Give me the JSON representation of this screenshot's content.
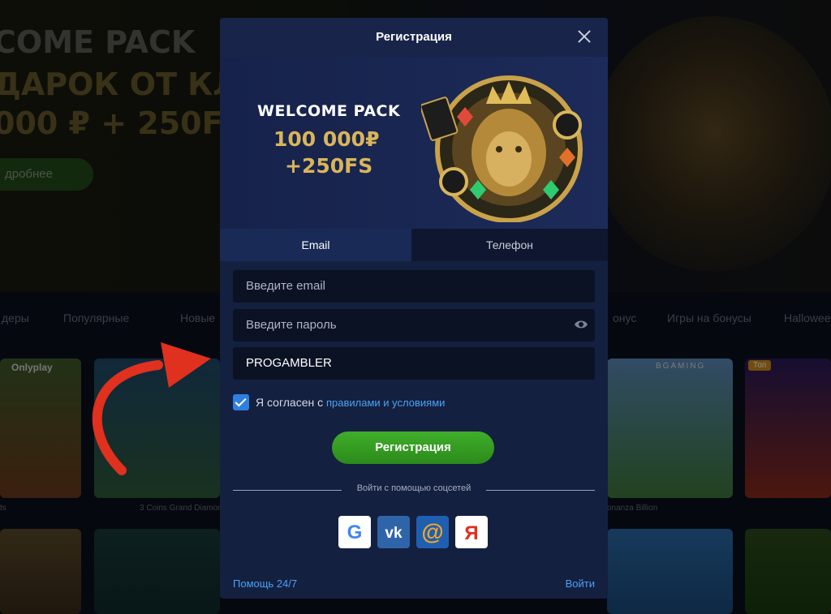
{
  "background": {
    "hero": {
      "title_line1": "COME PACK",
      "title_line2": "ДАРОК ОТ КЛУ",
      "title_line3": "000 ₽ + 250FS",
      "button_label": "дробнее"
    },
    "categories": [
      "деры",
      "Популярные",
      "Новые",
      "онус",
      "Игры на бонусы",
      "Hallowee"
    ],
    "tiles": [
      {
        "label": "ts",
        "provider": "Onlyplay"
      },
      {
        "label": "3 Coins Grand Diamond"
      },
      {
        "label": "onanza Billion",
        "provider": "BGAMING"
      },
      {
        "label": "Wi",
        "badge": "Топ"
      }
    ]
  },
  "modal": {
    "title": "Регистрация",
    "banner": {
      "line1": "WELCOME PACK",
      "line2": "100 000₽",
      "line3": "+250FS"
    },
    "tabs": [
      {
        "label": "Email",
        "active": true
      },
      {
        "label": "Телефон",
        "active": false
      }
    ],
    "fields": {
      "email_placeholder": "Введите email",
      "password_placeholder": "Введите пароль",
      "promo_value": "PROGAMBLER"
    },
    "agree": {
      "checked": true,
      "text": "Я согласен с ",
      "link": "правилами и условиями"
    },
    "register_button": "Регистрация",
    "social_label": "Войти с помощью соцсетей",
    "social": [
      {
        "name": "google",
        "glyph": "G"
      },
      {
        "name": "vk",
        "glyph": "vk"
      },
      {
        "name": "mail",
        "glyph": "@"
      },
      {
        "name": "yandex",
        "glyph": "Я"
      }
    ],
    "help_link": "Помощь 24/7",
    "login_link": "Войти"
  },
  "colors": {
    "modal_bg": "#142040",
    "accent_green": "#3fae2a",
    "link_blue": "#4aa2f5",
    "gold": "#d9b55a",
    "arrow_red": "#e0301e"
  }
}
